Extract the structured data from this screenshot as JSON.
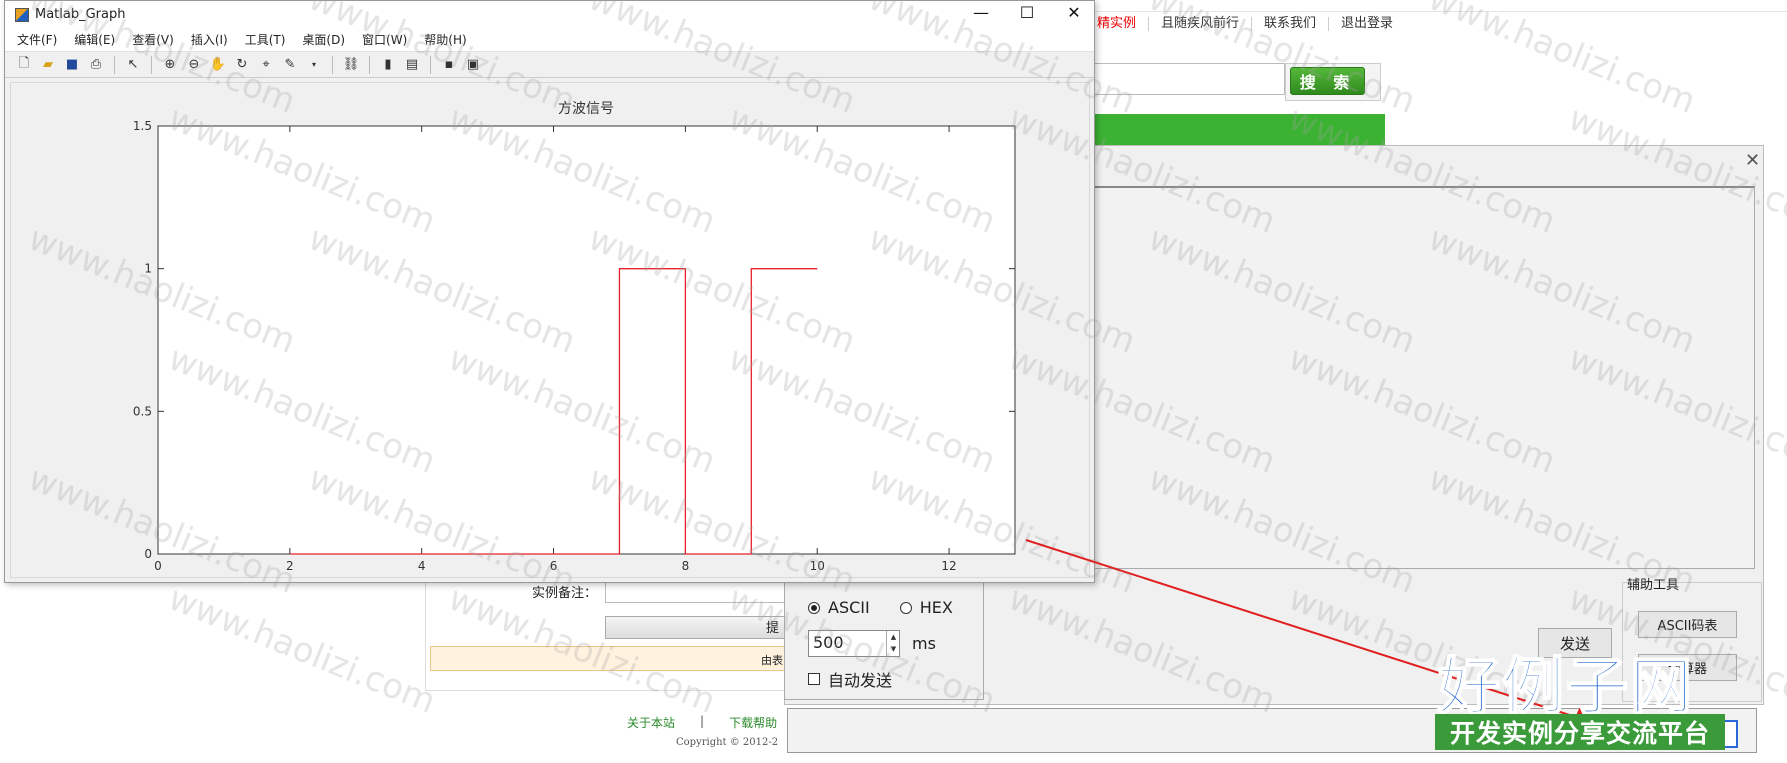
{
  "matlab": {
    "title": "Matlab_Graph",
    "menu": [
      "文件(F)",
      "编辑(E)",
      "查看(V)",
      "插入(I)",
      "工具(T)",
      "桌面(D)",
      "窗口(W)",
      "帮助(H)"
    ]
  },
  "chart_data": {
    "type": "line",
    "title": "方波信号",
    "xlim": [
      0,
      13
    ],
    "ylim": [
      0,
      1.5
    ],
    "xticks": [
      0,
      2,
      4,
      6,
      8,
      10,
      12
    ],
    "yticks": [
      0,
      0.5,
      1,
      1.5
    ],
    "xtick_labels": [
      "0",
      "2",
      "4",
      "6",
      "8",
      "10",
      "12"
    ],
    "ytick_labels": [
      "0",
      "0.5",
      "1",
      "1.5"
    ],
    "grid": false,
    "series": [
      {
        "color": "#e8202a",
        "x": [
          2,
          7,
          7,
          8,
          8,
          9,
          9,
          10
        ],
        "y": [
          0,
          0,
          1,
          1,
          0,
          0,
          1,
          1
        ]
      }
    ]
  },
  "browser": {
    "nav": [
      "精实例",
      "且随疾风前行",
      "联系我们",
      "退出登录"
    ],
    "search_button": "搜 索"
  },
  "serial": {
    "ascii_label": "ASCII",
    "hex_label": "HEX",
    "interval_value": "500",
    "interval_unit": "ms",
    "auto_send_label": "自动发送",
    "send_button": "发送",
    "tools_label": "辅助工具",
    "ascii_table_button": "ASCII码表",
    "tool_button_2": "计算器"
  },
  "form": {
    "note_label": "实例备注：",
    "submit_label": "提",
    "tip_text": "由表"
  },
  "footer": {
    "links": [
      "关于本站",
      "|",
      "下载帮助"
    ],
    "copyright": "Copyright © 2012-2"
  },
  "watermark": {
    "text": "www.haolizi.com",
    "logo_main": "好例子网",
    "logo_sub": "开发实例分享交流平台"
  }
}
